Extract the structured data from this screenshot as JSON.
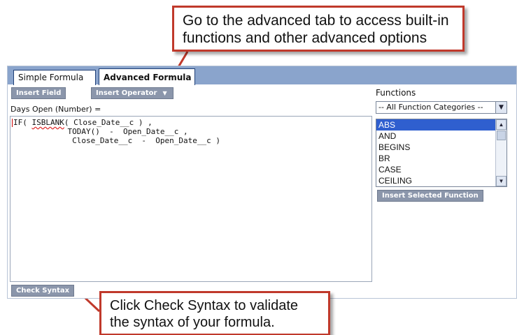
{
  "callouts": {
    "top": {
      "line1": "Go to the advanced tab to access built-in",
      "line2": "functions and other advanced options"
    },
    "bottom": {
      "line1": "Click Check Syntax to validate",
      "line2": "the syntax of your formula."
    },
    "border_color": "#c0392b"
  },
  "tabs": {
    "simple": "Simple Formula",
    "advanced": "Advanced Formula"
  },
  "toolbar": {
    "insert_field": "Insert Field",
    "insert_operator": "Insert Operator",
    "operator_caret": "▼"
  },
  "formula": {
    "label": "Days Open (Number) =",
    "line1_func": "IF( ",
    "line1_err": "ISBLANK",
    "line1_rest": "( Close_Date__c ) ,",
    "line2": "            TODAY()  -  Open_Date__c ,",
    "line3": "             Close_Date__c  -  Open_Date__c )"
  },
  "functions": {
    "label": "Functions",
    "category_selected": "-- All Function Categories --",
    "dropdown_icon": "▼",
    "items": [
      "ABS",
      "AND",
      "BEGINS",
      "BR",
      "CASE",
      "CEILING"
    ],
    "selected_index": 0,
    "insert_button": "Insert Selected Function",
    "scroll_up_icon": "▲",
    "scroll_down_icon": "▼"
  },
  "footer": {
    "check_syntax": "Check Syntax"
  },
  "colors": {
    "tabstrip": "#8aa4cc",
    "button": "#8b96ab",
    "selection": "#2f5fcf"
  }
}
